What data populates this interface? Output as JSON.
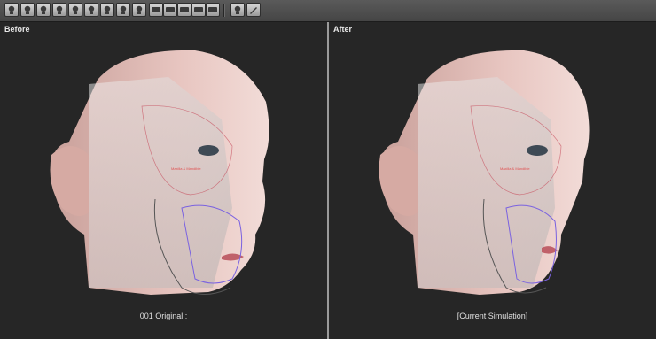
{
  "toolbar": {
    "buttons_group1": [
      "face-front-icon",
      "face-left-icon",
      "face-right-icon",
      "face-three-quarter-icon",
      "face-profile-icon",
      "face-smile-icon",
      "face-top-icon",
      "face-bottom-icon",
      "face-wireframe-icon"
    ],
    "buttons_group2": [
      "ceph-view-icon",
      "dental-arch-icon",
      "airway-icon",
      "cranium-icon",
      "jaw-icon"
    ],
    "buttons_group3": [
      "face-mask-icon",
      "pen-tool-icon"
    ]
  },
  "views": {
    "before": {
      "title": "Before",
      "caption": "001 Original :",
      "annotation": "Maxilla & Mandible"
    },
    "after": {
      "title": "After",
      "caption": "[Current Simulation]",
      "annotation": "Maxilla & Mandible"
    }
  },
  "colors": {
    "skin": "#e7c4bf",
    "skull_overlay": "#cfcfcf",
    "outline_red": "#c85060",
    "outline_blue": "#7a62e0",
    "background": "#262626"
  }
}
